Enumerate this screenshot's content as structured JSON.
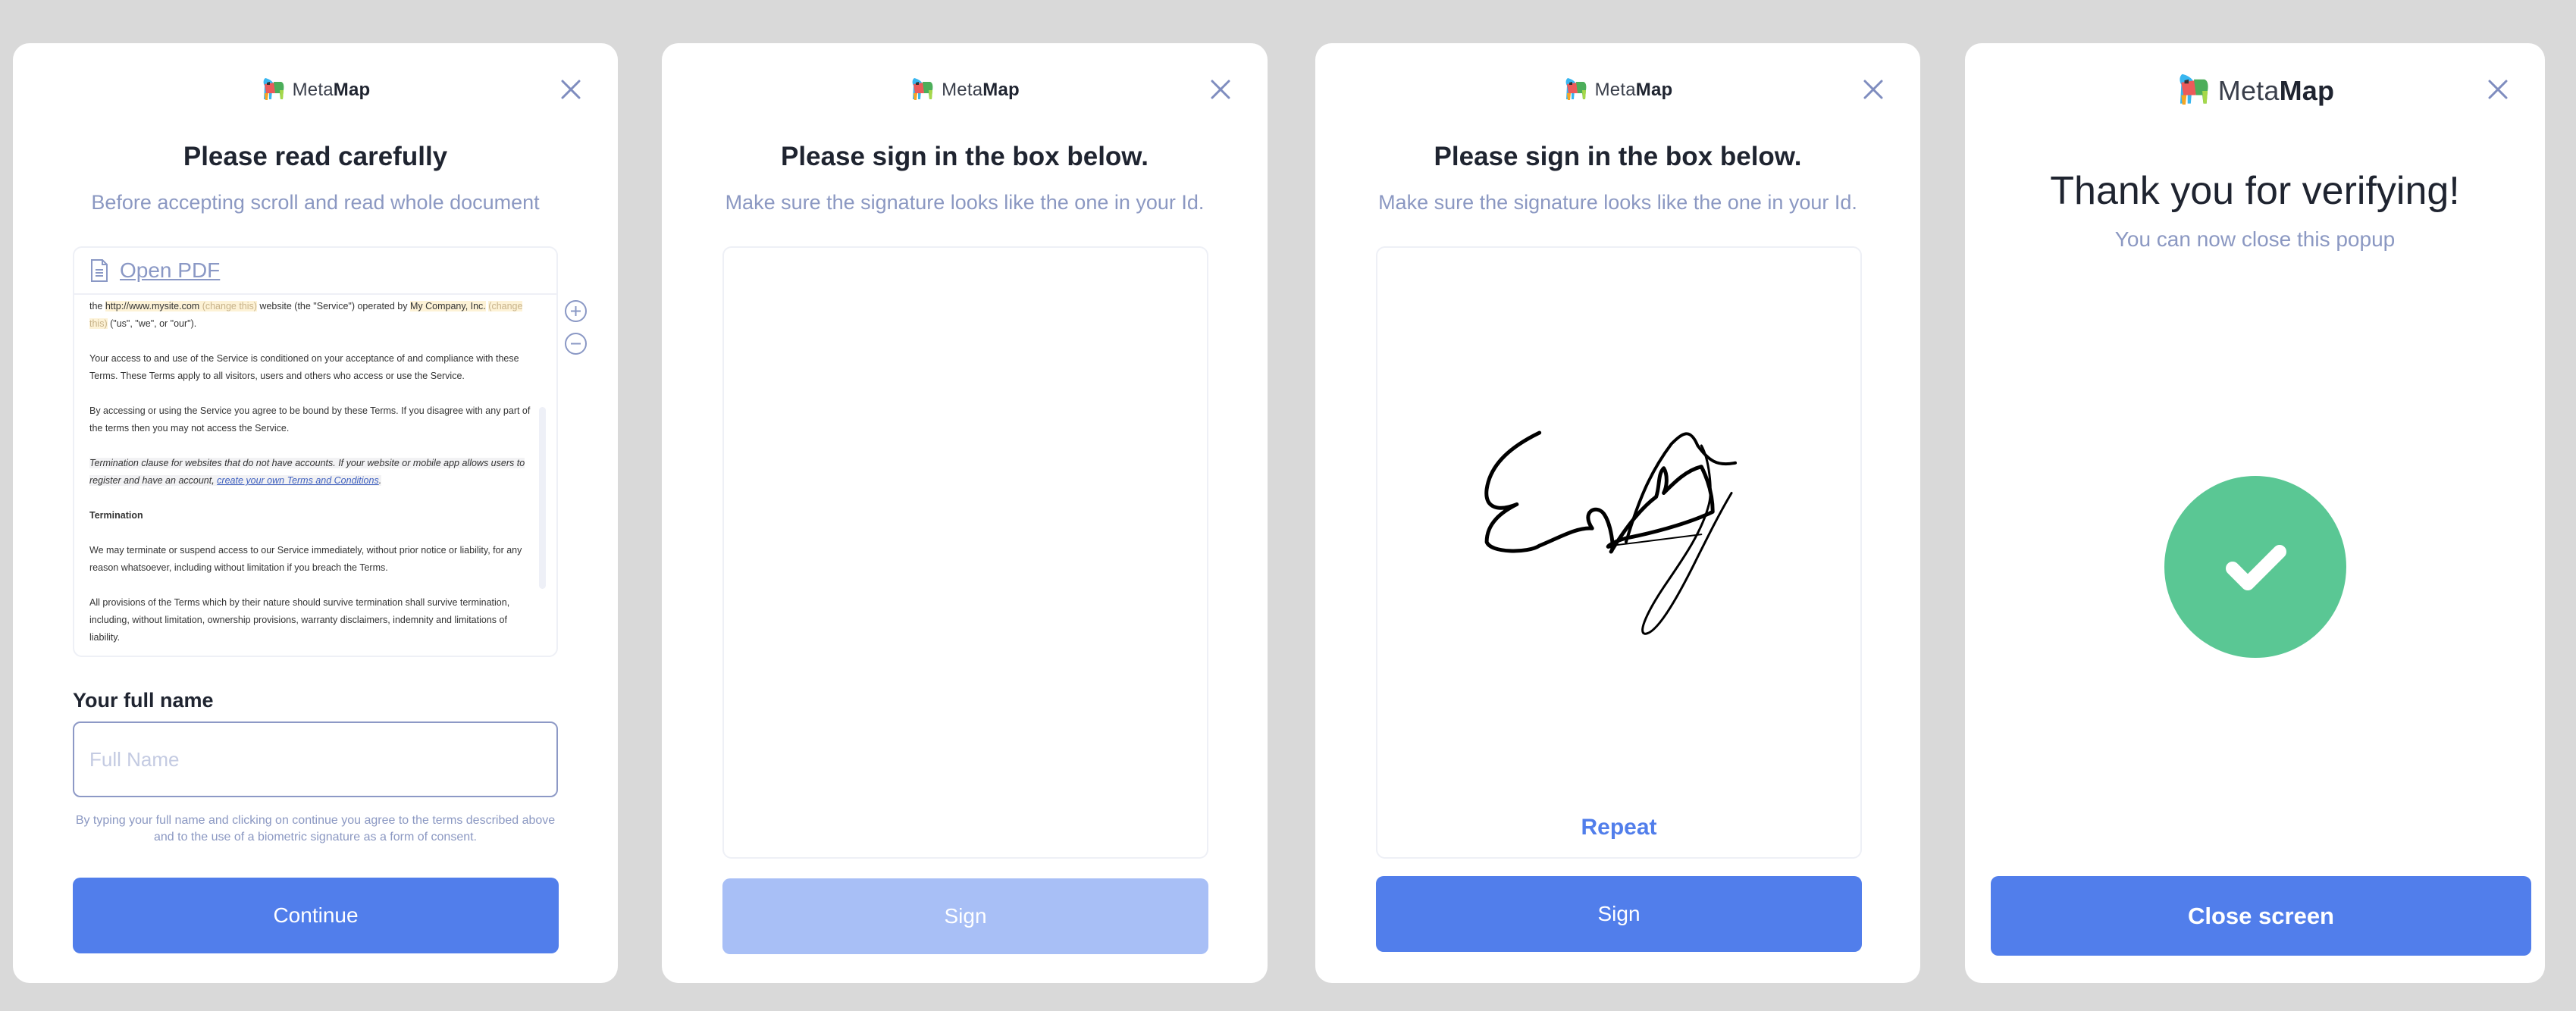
{
  "brand": {
    "name_light": "Meta",
    "name_bold": "Map"
  },
  "colors": {
    "primary": "#517eeb",
    "primary_disabled": "#a8bff6",
    "success": "#5ac794",
    "muted_text": "#8b98c2",
    "heading": "#1f2430"
  },
  "screens": [
    {
      "title": "Please read carefully",
      "subtitle": "Before accepting scroll and read whole document",
      "document": {
        "open_pdf_label": "Open PDF",
        "paragraphs": {
          "p1_a": "the ",
          "p1_url": "http://www.mysite.com",
          "p1_change1": "(change this)",
          "p1_b": " website (the \"Service\") operated by ",
          "p1_company": "My Company, Inc.",
          "p1_change2": "(change this)",
          "p1_c": " (\"us\", \"we\", or \"our\").",
          "p2": "Your access to and use of the Service is conditioned on your acceptance of and compliance with these Terms. These Terms apply to all visitors, users and others who access or use the Service.",
          "p3": "By accessing or using the Service you agree to be bound by these Terms. If you disagree with any part of the terms then you may not access the Service.",
          "p4": "Termination clause for websites that do not have accounts. If your website or mobile app allows users to register and have an account, ",
          "p4_link": "create your own Terms and Conditions",
          "p4_end": ".",
          "heading": "Termination",
          "p5": "We may terminate or suspend access to our Service immediately, without prior notice or liability, for any reason whatsoever, including without limitation if you breach the Terms.",
          "p6": "All provisions of the Terms which by their nature should survive termination shall survive termination, including, without limitation, ownership provisions, warranty disclaimers, indemnity and limitations of liability."
        },
        "zoom_in_icon": "plus-circle-icon",
        "zoom_out_icon": "minus-circle-icon"
      },
      "field_label": "Your full name",
      "input_value": "",
      "input_placeholder": "Full Name",
      "consent_text": "By typing your full name and clicking on continue you agree to the terms described above and to the use of a biometric signature as a form of consent.",
      "button_label": "Continue"
    },
    {
      "title": "Please sign in the box below.",
      "subtitle": "Make sure the signature looks like the one in your Id.",
      "button_label": "Sign",
      "button_state": "disabled"
    },
    {
      "title": "Please sign in the box below.",
      "subtitle": "Make sure the signature looks like the one in your Id.",
      "repeat_label": "Repeat",
      "button_label": "Sign",
      "button_state": "enabled"
    },
    {
      "title": "Thank you for verifying!",
      "subtitle": "You can now close this popup",
      "status_icon": "check-circle-icon",
      "button_label": "Close screen"
    }
  ]
}
